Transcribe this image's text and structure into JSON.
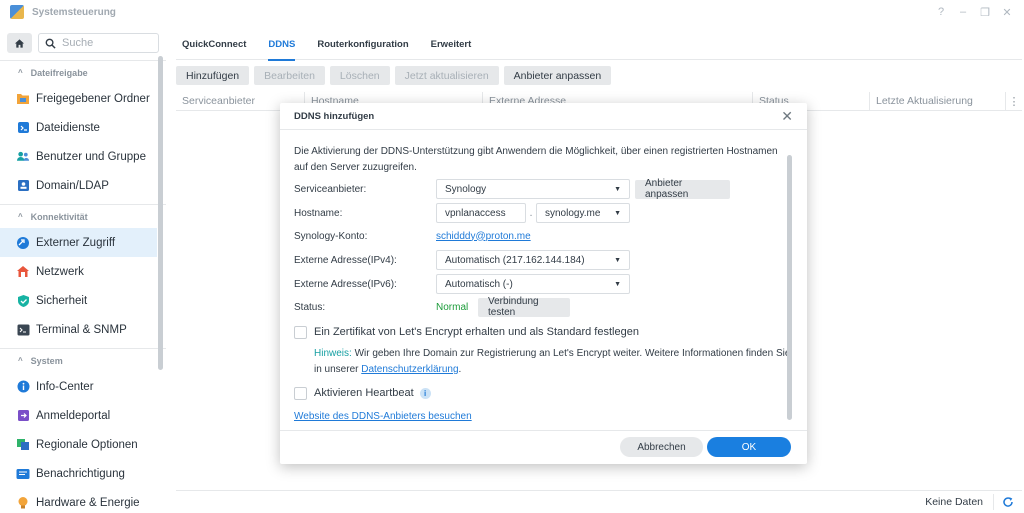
{
  "window": {
    "title": "Systemsteuerung",
    "controls": [
      "?",
      "–",
      "❐",
      "✕"
    ]
  },
  "sidebar": {
    "search_placeholder": "Suche",
    "sections": [
      {
        "title": "Dateifreigabe",
        "items": [
          {
            "label": "Freigegebener Ordner",
            "icon": "folder-icon"
          },
          {
            "label": "Dateidienste",
            "icon": "file-services-icon"
          },
          {
            "label": "Benutzer und Gruppe",
            "icon": "users-icon"
          },
          {
            "label": "Domain/LDAP",
            "icon": "domain-icon"
          }
        ]
      },
      {
        "title": "Konnektivität",
        "items": [
          {
            "label": "Externer Zugriff",
            "icon": "external-access-icon",
            "active": true
          },
          {
            "label": "Netzwerk",
            "icon": "network-icon"
          },
          {
            "label": "Sicherheit",
            "icon": "shield-icon"
          },
          {
            "label": "Terminal & SNMP",
            "icon": "terminal-icon"
          }
        ]
      },
      {
        "title": "System",
        "items": [
          {
            "label": "Info-Center",
            "icon": "info-center-icon"
          },
          {
            "label": "Anmeldeportal",
            "icon": "login-portal-icon"
          },
          {
            "label": "Regionale Optionen",
            "icon": "regional-icon"
          },
          {
            "label": "Benachrichtigung",
            "icon": "notification-icon"
          },
          {
            "label": "Hardware & Energie",
            "icon": "bulb-icon"
          }
        ]
      }
    ]
  },
  "main": {
    "tabs": [
      "QuickConnect",
      "DDNS",
      "Routerkonfiguration",
      "Erweitert"
    ],
    "active_tab": "DDNS",
    "toolbar": {
      "add": "Hinzufügen",
      "edit": "Bearbeiten",
      "delete": "Löschen",
      "update_now": "Jetzt aktualisieren",
      "customize_provider": "Anbieter anpassen"
    },
    "columns": [
      "Serviceanbieter",
      "Hostname",
      "Externe Adresse",
      "Status",
      "Letzte Aktualisierung"
    ],
    "footer_text": "Keine Daten"
  },
  "dialog": {
    "title": "DDNS hinzufügen",
    "description": "Die Aktivierung der DDNS-Unterstützung gibt Anwendern die Möglichkeit, über einen registrierten Hostnamen auf den Server zuzugreifen.",
    "labels": {
      "provider": "Serviceanbieter:",
      "hostname": "Hostname:",
      "account": "Synology-Konto:",
      "ipv4": "Externe Adresse(IPv4):",
      "ipv6": "Externe Adresse(IPv6):",
      "status": "Status:"
    },
    "values": {
      "provider": "Synology",
      "hostname": "vpnlanaccess",
      "dot": ".",
      "domain": "synology.me",
      "account": "schidddy@proton.me",
      "ipv4": "Automatisch (217.162.144.184)",
      "ipv6": "Automatisch (-)",
      "status": "Normal"
    },
    "buttons": {
      "customize_provider": "Anbieter anpassen",
      "test_connection": "Verbindung testen",
      "cancel": "Abbrechen",
      "ok": "OK"
    },
    "letsencrypt_label": "Ein Zertifikat von Let's Encrypt erhalten und als Standard festlegen",
    "hint_prefix": "Hinweis:",
    "hint_text": " Wir geben Ihre Domain zur Registrierung an Let's Encrypt weiter. Weitere Informationen finden Sie in unserer ",
    "privacy_link": "Datenschutzerklärung",
    "hint_suffix": ".",
    "heartbeat_label": "Aktivieren Heartbeat",
    "provider_website_link": "Website des DDNS-Anbieters besuchen"
  }
}
